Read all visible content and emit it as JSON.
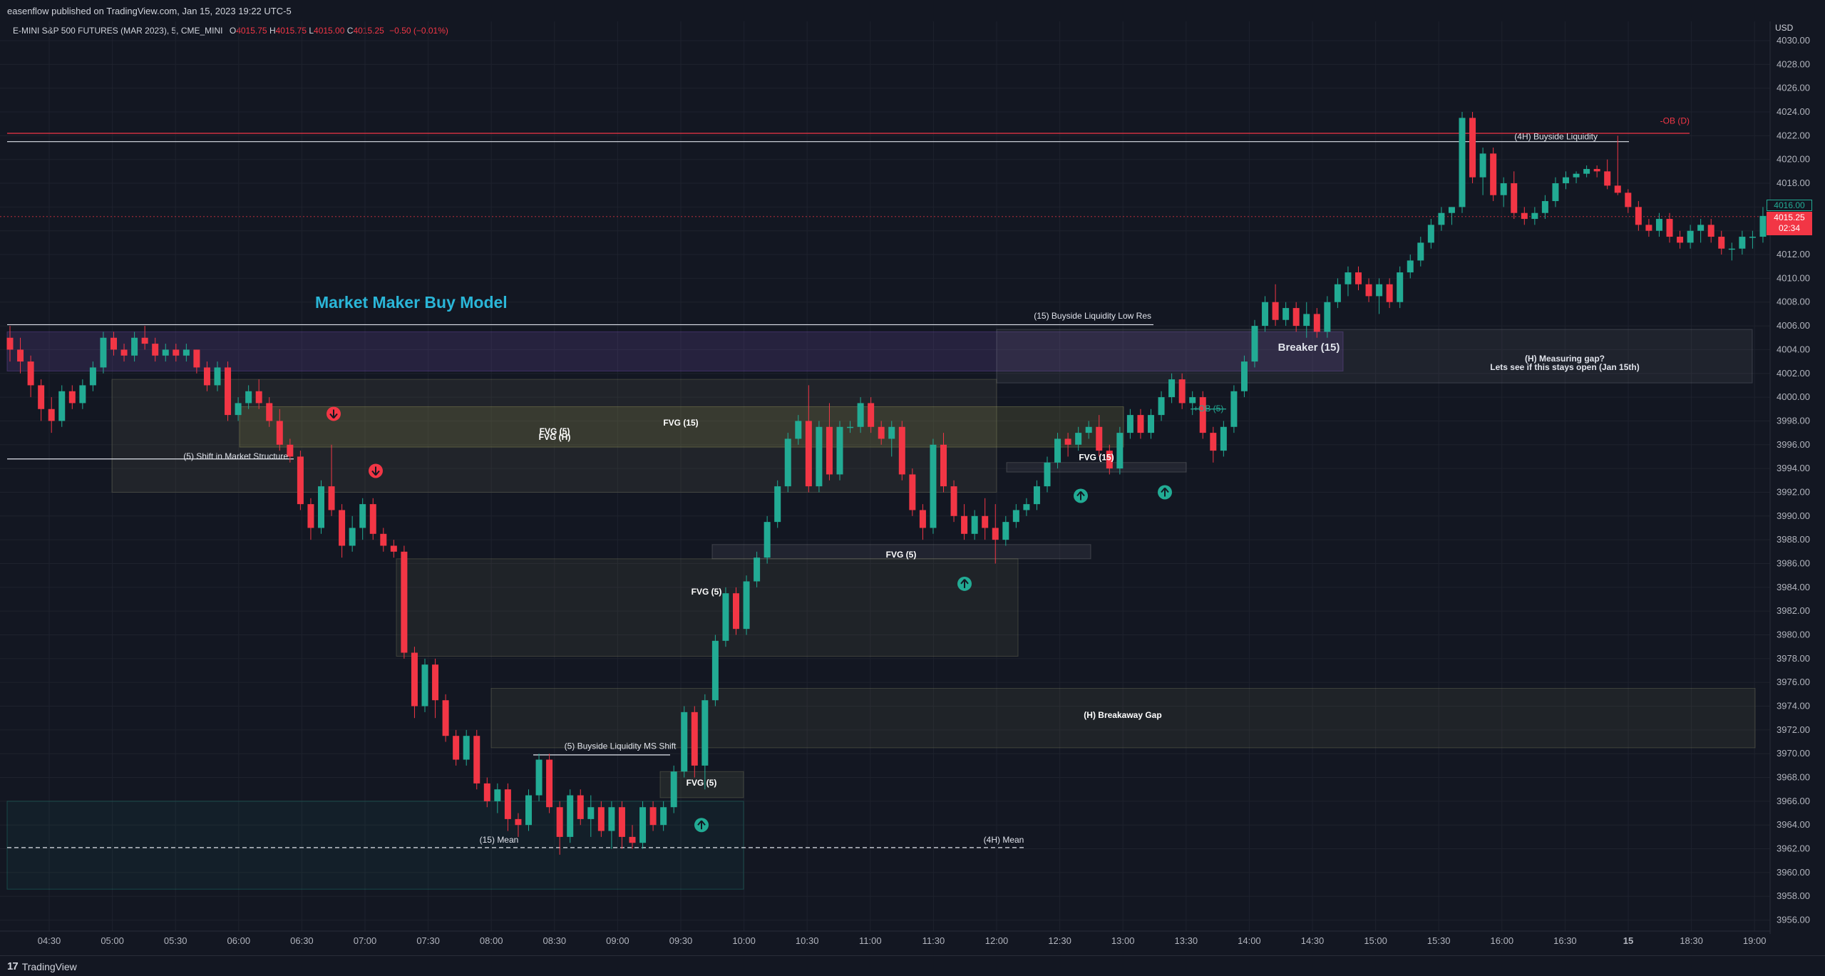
{
  "header": {
    "publish_line": "easenflow published on TradingView.com, Jan 15, 2023 19:22 UTC-5",
    "symbol": "E-MINI S&P 500 FUTURES (MAR 2023), 5, CME_MINI",
    "ohlc": {
      "o_label": "O",
      "o": "4015.75",
      "h_label": "H",
      "h": "4015.75",
      "l_label": "L",
      "l": "4015.00",
      "c_label": "C",
      "c": "4015.25",
      "change": "−0.50 (−0.01%)"
    }
  },
  "axis": {
    "currency": "USD",
    "current_price": "4015.25",
    "countdown": "02:34",
    "marker_price": "4016.00"
  },
  "footer": {
    "brand": "TradingView"
  },
  "colors": {
    "up": "#22ab94",
    "down": "#f23645",
    "bg": "#131722",
    "title": "#2ab6d8"
  },
  "chart_data": {
    "type": "candlestick",
    "title": "Market Maker Buy Model",
    "ylim": [
      3955,
      4031
    ],
    "y_ticks": [
      "4030.00",
      "4028.00",
      "4026.00",
      "4024.00",
      "4022.00",
      "4020.00",
      "4018.00",
      "4016.00",
      "4014.00",
      "4012.00",
      "4010.00",
      "4008.00",
      "4006.00",
      "4004.00",
      "4002.00",
      "4000.00",
      "3998.00",
      "3996.00",
      "3994.00",
      "3992.00",
      "3990.00",
      "3988.00",
      "3986.00",
      "3984.00",
      "3982.00",
      "3980.00",
      "3978.00",
      "3976.00",
      "3974.00",
      "3972.00",
      "3970.00",
      "3968.00",
      "3966.00",
      "3964.00",
      "3962.00",
      "3960.00",
      "3958.00",
      "3956.00"
    ],
    "x_ticks": [
      "04:30",
      "05:00",
      "05:30",
      "06:00",
      "06:30",
      "07:00",
      "07:30",
      "08:00",
      "08:30",
      "09:00",
      "09:30",
      "10:00",
      "10:30",
      "11:00",
      "11:30",
      "12:00",
      "12:30",
      "13:00",
      "13:30",
      "14:00",
      "14:30",
      "15:00",
      "15:30",
      "16:00",
      "16:30",
      "15",
      "18:30",
      "19:00"
    ],
    "candles": [
      [
        4005,
        4006,
        4003,
        4004
      ],
      [
        4004,
        4005,
        4002,
        4003
      ],
      [
        4003,
        4003.5,
        4000,
        4001
      ],
      [
        4001,
        4001.5,
        3998,
        3999
      ],
      [
        3999,
        4000,
        3997,
        3998
      ],
      [
        3998,
        4001,
        3997.5,
        4000.5
      ],
      [
        4000.5,
        4001,
        3999,
        3999.5
      ],
      [
        3999.5,
        4001.5,
        3999,
        4001
      ],
      [
        4001,
        4003,
        4000.5,
        4002.5
      ],
      [
        4002.5,
        4005.5,
        4002,
        4005
      ],
      [
        4005,
        4005.5,
        4003.5,
        4004
      ],
      [
        4004,
        4004.5,
        4003,
        4003.5
      ],
      [
        4003.5,
        4005.5,
        4003,
        4005
      ],
      [
        4005,
        4006,
        4004,
        4004.5
      ],
      [
        4004.5,
        4005,
        4003,
        4003.5
      ],
      [
        4003.5,
        4004.5,
        4003,
        4004
      ],
      [
        4004,
        4004.5,
        4003,
        4003.5
      ],
      [
        4003.5,
        4004.5,
        4003,
        4004
      ],
      [
        4004,
        4004,
        4002,
        4002.5
      ],
      [
        4002.5,
        4003,
        4000.5,
        4001
      ],
      [
        4001,
        4003,
        4000.5,
        4002.5
      ],
      [
        4002.5,
        4003,
        3998,
        3998.5
      ],
      [
        3998.5,
        4000,
        3998,
        3999.5
      ],
      [
        3999.5,
        4001,
        3999,
        4000.5
      ],
      [
        4000.5,
        4001.5,
        3999,
        3999.5
      ],
      [
        3999.5,
        4000,
        3997.5,
        3998
      ],
      [
        3998,
        3999,
        3995.5,
        3996
      ],
      [
        3996,
        3996.5,
        3994.5,
        3995
      ],
      [
        3995,
        3995.5,
        3990.5,
        3991
      ],
      [
        3991,
        3991.5,
        3988,
        3989
      ],
      [
        3989,
        3993,
        3988.5,
        3992.5
      ],
      [
        3992.5,
        3996,
        3990,
        3990.5
      ],
      [
        3990.5,
        3991,
        3986.5,
        3987.5
      ],
      [
        3987.5,
        3990,
        3987,
        3989
      ],
      [
        3989,
        3991.5,
        3988,
        3991
      ],
      [
        3991,
        3991.5,
        3988,
        3988.5
      ],
      [
        3988.5,
        3989,
        3987,
        3987.5
      ],
      [
        3987.5,
        3988,
        3986.5,
        3987
      ],
      [
        3987,
        3987.5,
        3978,
        3978.5
      ],
      [
        3978.5,
        3979,
        3973,
        3974
      ],
      [
        3974,
        3978,
        3973.5,
        3977.5
      ],
      [
        3977.5,
        3978,
        3973,
        3974.5
      ],
      [
        3974.5,
        3975,
        3971,
        3971.5
      ],
      [
        3971.5,
        3972,
        3969,
        3969.5
      ],
      [
        3969.5,
        3972,
        3969,
        3971.5
      ],
      [
        3971.5,
        3972,
        3967,
        3967.5
      ],
      [
        3967.5,
        3968,
        3965.5,
        3966
      ],
      [
        3966,
        3967.5,
        3965,
        3967
      ],
      [
        3967,
        3967.5,
        3963.5,
        3964.5
      ],
      [
        3964.5,
        3965,
        3963,
        3964
      ],
      [
        3964,
        3967,
        3963.5,
        3966.5
      ],
      [
        3966.5,
        3970,
        3966,
        3969.5
      ],
      [
        3969.5,
        3970,
        3965,
        3965.5
      ],
      [
        3965.5,
        3966,
        3961.5,
        3963
      ],
      [
        3963,
        3967,
        3962.5,
        3966.5
      ],
      [
        3966.5,
        3967,
        3964,
        3964.5
      ],
      [
        3964.5,
        3966.5,
        3963,
        3965.5
      ],
      [
        3965.5,
        3966,
        3963,
        3963.5
      ],
      [
        3963.5,
        3966,
        3962,
        3965.5
      ],
      [
        3965.5,
        3966,
        3962,
        3963
      ],
      [
        3963,
        3964,
        3962,
        3962.5
      ],
      [
        3962.5,
        3966,
        3962,
        3965.5
      ],
      [
        3965.5,
        3966,
        3963.5,
        3964
      ],
      [
        3964,
        3966,
        3963.5,
        3965.5
      ],
      [
        3965.5,
        3969,
        3965,
        3968.5
      ],
      [
        3968.5,
        3974,
        3968,
        3973.5
      ],
      [
        3973.5,
        3974,
        3968,
        3969
      ],
      [
        3969,
        3975,
        3967,
        3974.5
      ],
      [
        3974.5,
        3980,
        3974,
        3979.5
      ],
      [
        3979.5,
        3984,
        3979,
        3983.5
      ],
      [
        3983.5,
        3984,
        3980,
        3980.5
      ],
      [
        3980.5,
        3985,
        3980,
        3984.5
      ],
      [
        3984.5,
        3987,
        3984,
        3986.5
      ],
      [
        3986.5,
        3990,
        3986,
        3989.5
      ],
      [
        3989.5,
        3993,
        3989,
        3992.5
      ],
      [
        3992.5,
        3997,
        3992,
        3996.5
      ],
      [
        3996.5,
        3998.5,
        3996,
        3998
      ],
      [
        3998,
        4001,
        3992,
        3992.5
      ],
      [
        3992.5,
        3998,
        3992,
        3997.5
      ],
      [
        3997.5,
        3999.5,
        3993,
        3993.5
      ],
      [
        3993.5,
        3998,
        3993,
        3997.5
      ],
      [
        3997.5,
        3998,
        3997,
        3997.5
      ],
      [
        3997.5,
        4000,
        3997,
        3999.5
      ],
      [
        3999.5,
        4000,
        3997,
        3997.5
      ],
      [
        3997.5,
        3998,
        3996,
        3996.5
      ],
      [
        3996.5,
        3998,
        3995,
        3997.5
      ],
      [
        3997.5,
        3998,
        3993,
        3993.5
      ],
      [
        3993.5,
        3994,
        3990,
        3990.5
      ],
      [
        3990.5,
        3991,
        3988,
        3989
      ],
      [
        3989,
        3996.5,
        3988.5,
        3996
      ],
      [
        3996,
        3997,
        3992,
        3992.5
      ],
      [
        3992.5,
        3993,
        3989.5,
        3990
      ],
      [
        3990,
        3991,
        3988,
        3988.5
      ],
      [
        3988.5,
        3990.5,
        3988,
        3990
      ],
      [
        3990,
        3991.5,
        3988,
        3989
      ],
      [
        3989,
        3991,
        3986,
        3988
      ],
      [
        3988,
        3990,
        3987.5,
        3989.5
      ],
      [
        3989.5,
        3991,
        3989,
        3990.5
      ],
      [
        3990.5,
        3991.5,
        3990,
        3991
      ],
      [
        3991,
        3993,
        3990.5,
        3992.5
      ],
      [
        3992.5,
        3995,
        3992,
        3994.5
      ],
      [
        3994.5,
        3997,
        3994,
        3996.5
      ],
      [
        3996.5,
        3997,
        3995,
        3996
      ],
      [
        3996,
        3997.5,
        3995.5,
        3997
      ],
      [
        3997,
        3998,
        3996.5,
        3997.5
      ],
      [
        3997.5,
        3998.5,
        3995,
        3995.5
      ],
      [
        3995.5,
        3996,
        3993.5,
        3994
      ],
      [
        3994,
        3997.5,
        3993.5,
        3997
      ],
      [
        3997,
        3999,
        3996.5,
        3998.5
      ],
      [
        3998.5,
        3999,
        3996.5,
        3997
      ],
      [
        3997,
        3999,
        3996.5,
        3998.5
      ],
      [
        3998.5,
        4000.5,
        3998,
        4000
      ],
      [
        4000,
        4002,
        3999.5,
        4001.5
      ],
      [
        4001.5,
        4002,
        3999,
        3999.5
      ],
      [
        3999.5,
        4000.5,
        3998.5,
        4000
      ],
      [
        4000,
        4000.5,
        3996.5,
        3997
      ],
      [
        3997,
        3997.5,
        3994.5,
        3995.5
      ],
      [
        3995.5,
        3998,
        3995,
        3997.5
      ],
      [
        3997.5,
        4001,
        3997,
        4000.5
      ],
      [
        4000.5,
        4003.5,
        4000,
        4003
      ],
      [
        4003,
        4006.5,
        4002.5,
        4006
      ],
      [
        4006,
        4008.5,
        4005.5,
        4008
      ],
      [
        4008,
        4009.5,
        4006,
        4006.5
      ],
      [
        4006.5,
        4008,
        4006,
        4007.5
      ],
      [
        4007.5,
        4008,
        4005.5,
        4006
      ],
      [
        4006,
        4008,
        4005,
        4007
      ],
      [
        4007,
        4007.5,
        4005,
        4005.5
      ],
      [
        4005.5,
        4008.5,
        4005,
        4008
      ],
      [
        4008,
        4010,
        4007.5,
        4009.5
      ],
      [
        4009.5,
        4011,
        4008.5,
        4010.5
      ],
      [
        4010.5,
        4011,
        4009,
        4009.5
      ],
      [
        4009.5,
        4010,
        4008,
        4008.5
      ],
      [
        4008.5,
        4010,
        4007,
        4009.5
      ],
      [
        4009.5,
        4010,
        4007.5,
        4008
      ],
      [
        4008,
        4011,
        4007.5,
        4010.5
      ],
      [
        4010.5,
        4012,
        4010,
        4011.5
      ],
      [
        4011.5,
        4013.5,
        4011,
        4013
      ],
      [
        4013,
        4015,
        4012.5,
        4014.5
      ],
      [
        4014.5,
        4016,
        4014,
        4015.5
      ],
      [
        4015.5,
        4016,
        4014.5,
        4016
      ],
      [
        4016,
        4024,
        4015.5,
        4023.5
      ],
      [
        4023.5,
        4024,
        4018,
        4018.5
      ],
      [
        4018.5,
        4021,
        4017,
        4020.5
      ],
      [
        4020.5,
        4021,
        4016.5,
        4017
      ],
      [
        4017,
        4018.5,
        4016,
        4018
      ],
      [
        4018,
        4019,
        4015,
        4015.5
      ],
      [
        4015.5,
        4016,
        4014.5,
        4015
      ],
      [
        4015,
        4016,
        4014.5,
        4015.5
      ],
      [
        4015.5,
        4017,
        4015,
        4016.5
      ],
      [
        4016.5,
        4018.5,
        4016,
        4018
      ],
      [
        4018,
        4019,
        4017.5,
        4018.5
      ],
      [
        4018.5,
        4019,
        4018,
        4018.8
      ],
      [
        4018.8,
        4019.5,
        4018.5,
        4019.2
      ],
      [
        4019.2,
        4019.5,
        4018.5,
        4019
      ],
      [
        4019,
        4020,
        4017.5,
        4017.8
      ],
      [
        4017.8,
        4022,
        4017,
        4017.2
      ],
      [
        4017.2,
        4017.5,
        4015.5,
        4016
      ],
      [
        4016,
        4016.5,
        4014,
        4014.5
      ],
      [
        4014.5,
        4015,
        4013.5,
        4014
      ],
      [
        4014,
        4015.5,
        4013.5,
        4015
      ],
      [
        4015,
        4015.5,
        4013,
        4013.5
      ],
      [
        4013.5,
        4014,
        4012.5,
        4013
      ],
      [
        4013,
        4014.5,
        4012.5,
        4014
      ],
      [
        4014,
        4015,
        4013,
        4014.5
      ],
      [
        4014.5,
        4015,
        4013,
        4013.5
      ],
      [
        4013.5,
        4014,
        4012,
        4012.5
      ],
      [
        4012.5,
        4013,
        4011.5,
        4012.5
      ],
      [
        4012.5,
        4014,
        4012,
        4013.5
      ],
      [
        4013.5,
        4014,
        4012.5,
        4013.5
      ],
      [
        4013.5,
        4016,
        4013,
        4015.25
      ]
    ],
    "annotations": [
      {
        "text": "(4H) Buyside Liquidity"
      },
      {
        "text": "-OB (D)"
      },
      {
        "text": "(15) Buyside Liquidity Low Res"
      },
      {
        "text": "Breaker (15)"
      },
      {
        "text": "(H) Measuring gap?"
      },
      {
        "text": "Lets see if this stays open (Jan 15th)"
      },
      {
        "text": "+OB (5)"
      },
      {
        "text": "FVG (15)"
      },
      {
        "text": "FVG (5)"
      },
      {
        "text": "FVG (H)"
      },
      {
        "text": "(5) Shift in Market Structure"
      },
      {
        "text": "FVG (15)"
      },
      {
        "text": "FVG (5)"
      },
      {
        "text": "FVG (5)"
      },
      {
        "text": "(H) Breakaway Gap"
      },
      {
        "text": "(5) Buyside Liquidity  MS Shift"
      },
      {
        "text": "FVG (5)"
      },
      {
        "text": "(15) Mean"
      },
      {
        "text": "(4H) Mean"
      }
    ]
  }
}
